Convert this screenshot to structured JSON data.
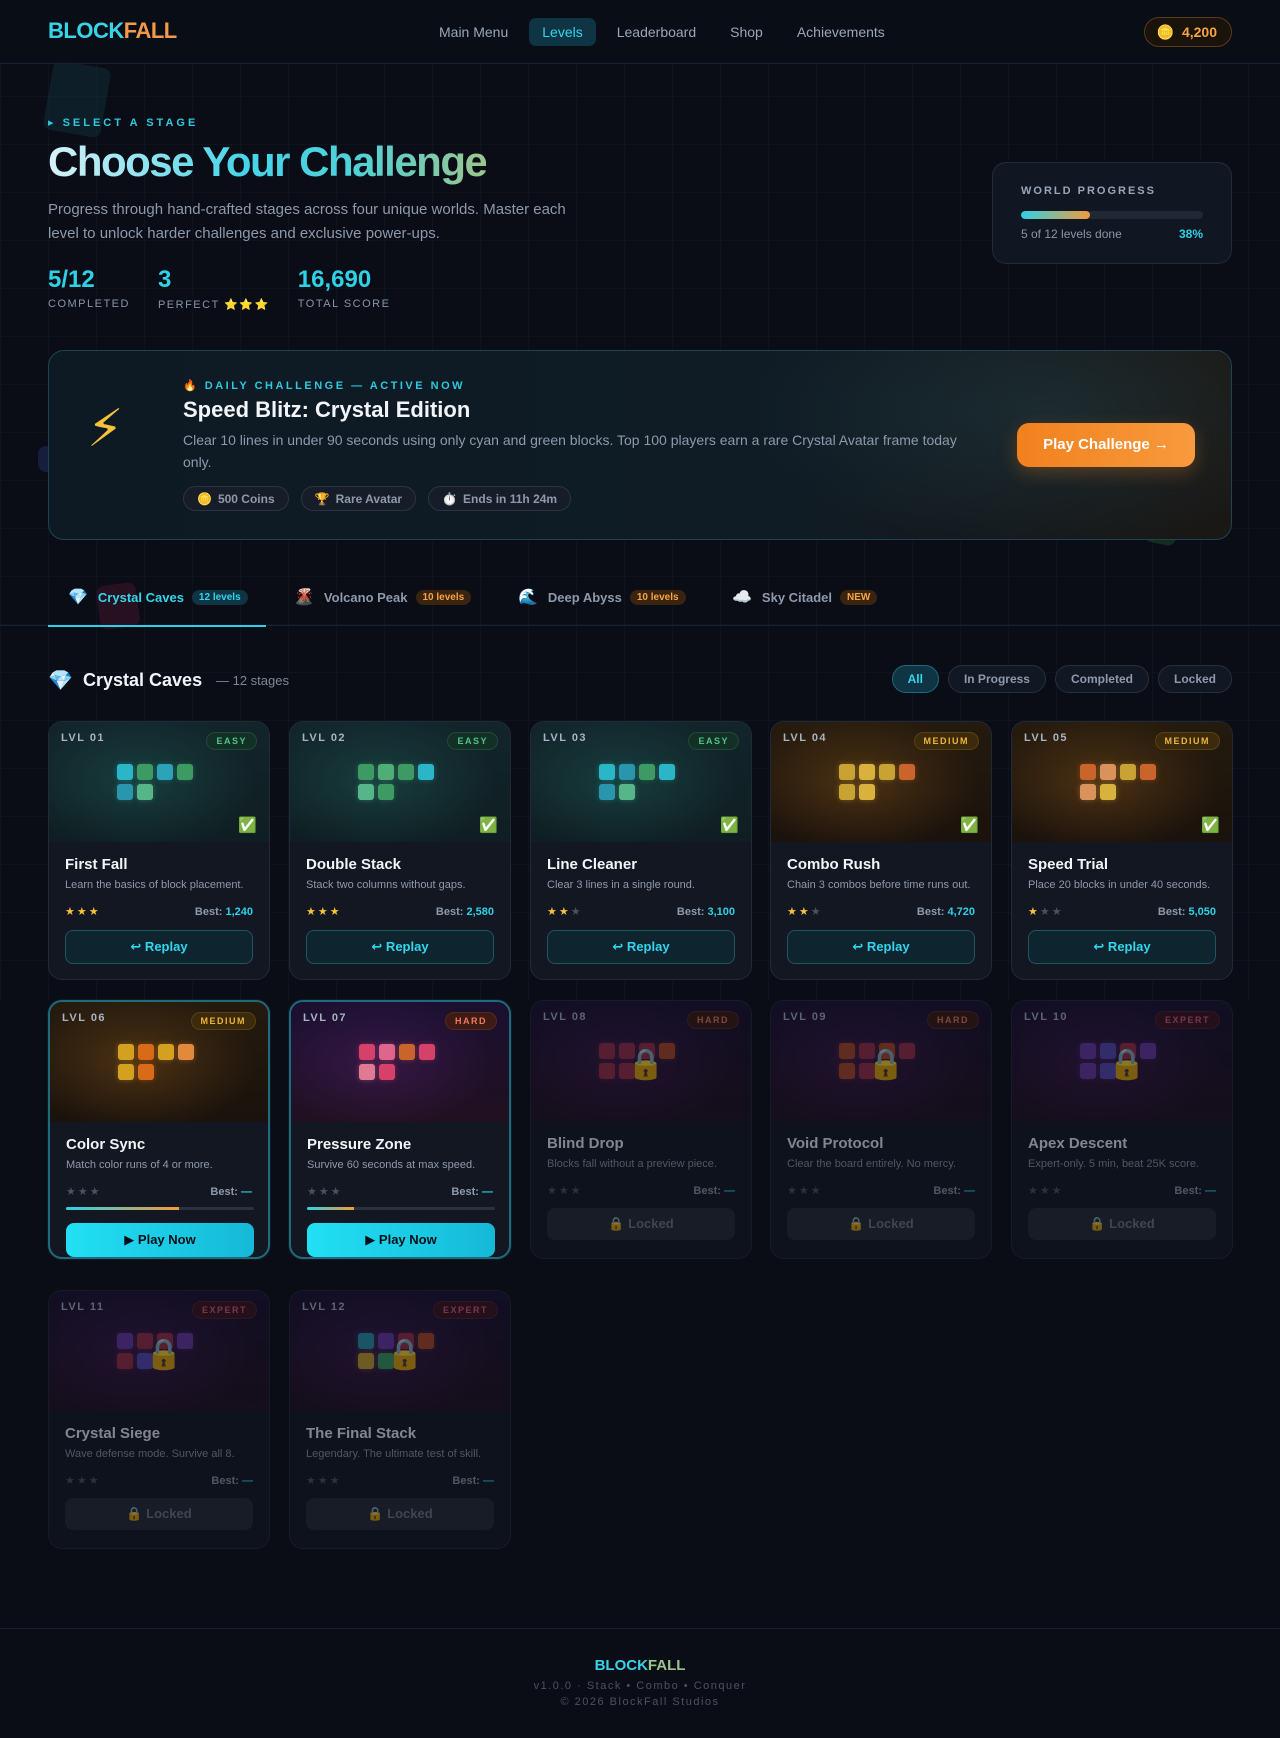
{
  "header": {
    "logo_a": "BLOCK",
    "logo_b": "FALL",
    "nav": [
      "Main Menu",
      "Levels",
      "Leaderboard",
      "Shop",
      "Achievements"
    ],
    "active_nav": 1,
    "coins": "4,200"
  },
  "hero": {
    "eyebrow": "▸ SELECT A STAGE",
    "title": "Choose Your Challenge",
    "subtitle": "Progress through hand-crafted stages across four unique worlds. Master each level to unlock harder challenges and exclusive power-ups.",
    "stats": [
      {
        "value": "5/12",
        "label": "COMPLETED"
      },
      {
        "value": "3",
        "label": "PERFECT ⭐⭐⭐"
      },
      {
        "value": "16,690",
        "label": "TOTAL SCORE"
      }
    ]
  },
  "world_progress": {
    "title": "WORLD PROGRESS",
    "caption": "5 of 12 levels done",
    "percent": "38%",
    "fraction": 0.38
  },
  "daily": {
    "eyebrow": "🔥 DAILY CHALLENGE — ACTIVE NOW",
    "title": "Speed Blitz: Crystal Edition",
    "description": "Clear 10 lines in under 90 seconds using only cyan and green blocks. Top 100 players earn a rare Crystal Avatar frame today only.",
    "chips": [
      {
        "icon": "🪙",
        "label": "500 Coins"
      },
      {
        "icon": "🏆",
        "label": "Rare Avatar"
      },
      {
        "icon": "⏱️",
        "label": "Ends in 11h 24m"
      }
    ],
    "cta": "Play Challenge →"
  },
  "worlds": [
    {
      "icon": "💎",
      "name": "Crystal Caves",
      "badge": "12 levels",
      "badge_style": "cyan"
    },
    {
      "icon": "🌋",
      "name": "Volcano Peak",
      "badge": "10 levels",
      "badge_style": "orange"
    },
    {
      "icon": "🌊",
      "name": "Deep Abyss",
      "badge": "10 levels",
      "badge_style": "orange"
    },
    {
      "icon": "☁️",
      "name": "Sky Citadel",
      "badge": "NEW",
      "badge_style": "new"
    }
  ],
  "section": {
    "icon": "💎",
    "title": "Crystal Caves",
    "subtitle": "— 12 stages",
    "filters": [
      "All",
      "In Progress",
      "Completed",
      "Locked"
    ],
    "active_filter": 0
  },
  "levels": [
    {
      "lvl": "LVL 01",
      "difficulty": "EASY",
      "title": "First Fall",
      "desc": "Learn the basics of block placement.",
      "stars": 3,
      "best": "1,240",
      "status": "completed",
      "button": "↩ Replay",
      "palette": [
        "#2bb6c8",
        "#3e9a63",
        "#2ba3b8",
        "#3e9a63",
        "#2a96ad",
        "#56b68a"
      ],
      "theme": "teal"
    },
    {
      "lvl": "LVL 02",
      "difficulty": "EASY",
      "title": "Double Stack",
      "desc": "Stack two columns without gaps.",
      "stars": 3,
      "best": "2,580",
      "status": "completed",
      "button": "↩ Replay",
      "palette": [
        "#3e9a63",
        "#4fae78",
        "#3e9a63",
        "#2bb6c8",
        "#56b68a",
        "#3e9a63"
      ],
      "theme": "teal"
    },
    {
      "lvl": "LVL 03",
      "difficulty": "EASY",
      "title": "Line Cleaner",
      "desc": "Clear 3 lines in a single round.",
      "stars": 2,
      "best": "3,100",
      "status": "completed",
      "button": "↩ Replay",
      "palette": [
        "#2bb6c8",
        "#2a96ad",
        "#3e9a63",
        "#2bb6c8",
        "#2a96ad",
        "#56b68a"
      ],
      "theme": "teal"
    },
    {
      "lvl": "LVL 04",
      "difficulty": "MEDIUM",
      "title": "Combo Rush",
      "desc": "Chain 3 combos before time runs out.",
      "stars": 2,
      "best": "4,720",
      "status": "completed",
      "button": "↩ Replay",
      "palette": [
        "#c8a233",
        "#d9b23d",
        "#c8a233",
        "#c9642a",
        "#c8a233",
        "#d9b23d"
      ],
      "theme": "amber"
    },
    {
      "lvl": "LVL 05",
      "difficulty": "MEDIUM",
      "title": "Speed Trial",
      "desc": "Place 20 blocks in under 40 seconds.",
      "stars": 1,
      "best": "5,050",
      "status": "completed",
      "button": "↩ Replay",
      "palette": [
        "#c9642a",
        "#d9935a",
        "#c8a233",
        "#c9642a",
        "#d9935a",
        "#d9b23d"
      ],
      "theme": "amber"
    },
    {
      "lvl": "LVL 06",
      "difficulty": "MEDIUM",
      "title": "Color Sync",
      "desc": "Match color runs of 4 or more.",
      "stars": 0,
      "best": "—",
      "status": "active",
      "progress": 0.6,
      "button": "▶ Play Now",
      "palette": [
        "#d4a020",
        "#d96a18",
        "#d4a020",
        "#e08a3a",
        "#d4a020",
        "#d96a18"
      ],
      "theme": "amber"
    },
    {
      "lvl": "LVL 07",
      "difficulty": "HARD",
      "title": "Pressure Zone",
      "desc": "Survive 60 seconds at max speed.",
      "stars": 0,
      "best": "—",
      "status": "active",
      "progress": 0.25,
      "button": "▶ Play Now",
      "palette": [
        "#d6416a",
        "#e0658a",
        "#c9642a",
        "#d6416a",
        "#e07a94",
        "#d6416a"
      ],
      "theme": "violet"
    },
    {
      "lvl": "LVL 08",
      "difficulty": "HARD",
      "title": "Blind Drop",
      "desc": "Blocks fall without a preview piece.",
      "stars": 0,
      "best": "—",
      "status": "locked",
      "button": "🔒 Locked",
      "palette": [
        "#9a2e4a",
        "#9a2e4a",
        "#9a2e4a",
        "#b04a2a",
        "#9a2e4a",
        "#9a2e4a"
      ],
      "theme": "violet"
    },
    {
      "lvl": "LVL 09",
      "difficulty": "HARD",
      "title": "Void Protocol",
      "desc": "Clear the board entirely. No mercy.",
      "stars": 0,
      "best": "—",
      "status": "locked",
      "button": "🔒 Locked",
      "palette": [
        "#b04a2a",
        "#9a2e4a",
        "#b04a2a",
        "#9a2e4a",
        "#b04a2a",
        "#9a2e4a"
      ],
      "theme": "violet"
    },
    {
      "lvl": "LVL 10",
      "difficulty": "EXPERT",
      "title": "Apex Descent",
      "desc": "Expert-only. 5 min, beat 25K score.",
      "stars": 0,
      "best": "—",
      "status": "locked",
      "button": "🔒 Locked",
      "palette": [
        "#6a3aa8",
        "#5a4ab8",
        "#9a2e4a",
        "#6a3aa8",
        "#6a3aa8",
        "#5a4ab8"
      ],
      "theme": "violet"
    },
    {
      "lvl": "LVL 11",
      "difficulty": "EXPERT",
      "title": "Crystal Siege",
      "desc": "Wave defense mode. Survive all 8.",
      "stars": 0,
      "best": "—",
      "status": "locked",
      "button": "🔒 Locked",
      "palette": [
        "#6a3aa8",
        "#9a2e4a",
        "#9a2e4a",
        "#6a3aa8",
        "#9a2e4a",
        "#5a4ab8"
      ],
      "theme": "violet"
    },
    {
      "lvl": "LVL 12",
      "difficulty": "EXPERT",
      "title": "The Final Stack",
      "desc": "Legendary. The ultimate test of skill.",
      "stars": 0,
      "best": "—",
      "status": "locked",
      "button": "🔒 Locked",
      "palette": [
        "#2a96ad",
        "#6a3aa8",
        "#9a2e4a",
        "#b04a2a",
        "#c8a233",
        "#3e9a63"
      ],
      "theme": "violet"
    }
  ],
  "best_label": "Best:",
  "footer": {
    "logo_a": "BLOCK",
    "logo_b": "FALL",
    "version": "v1.0.0 · Stack • Combo • Conquer",
    "copyright": "© 2026 BlockFall Studios"
  }
}
